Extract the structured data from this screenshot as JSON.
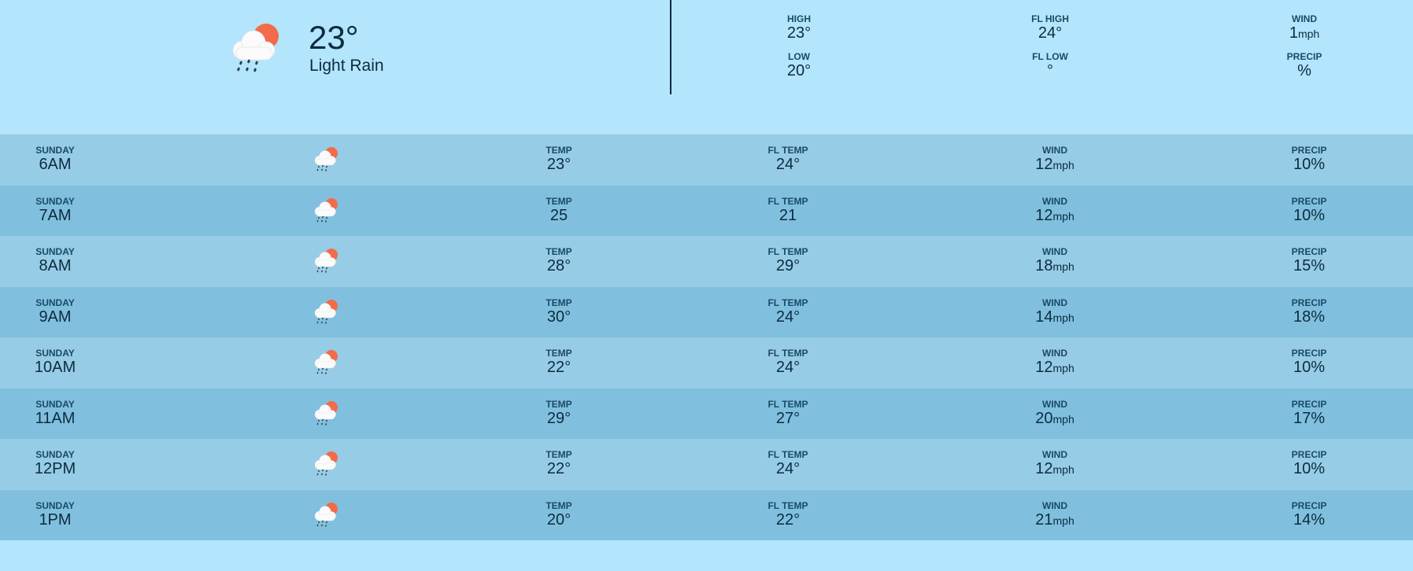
{
  "current": {
    "icon": "cloud-sun-rain-icon",
    "temp": "23°",
    "condition": "Light Rain"
  },
  "stats": {
    "high": {
      "label": "HIGH",
      "value": "23°"
    },
    "low": {
      "label": "LOW",
      "value": "20°"
    },
    "fl_high": {
      "label": "FL HIGH",
      "value": "24°"
    },
    "fl_low": {
      "label": "FL LOW",
      "value": "°"
    },
    "wind": {
      "label": "WIND",
      "value": "1",
      "unit": "mph"
    },
    "precip": {
      "label": "PRECIP",
      "value": "%"
    }
  },
  "labels": {
    "temp": "TEMP",
    "fl_temp": "FL TEMP",
    "wind": "WIND",
    "precip": "PRECIP",
    "wind_unit": "mph"
  },
  "colors": {
    "background": "#b3e5fc",
    "row_odd": "#96cce6",
    "row_even": "#80c0de",
    "sun": "#f26b4a",
    "text": "#0d2b3e"
  },
  "hourly": [
    {
      "day": "SUNDAY",
      "time": "6AM",
      "icon": "cloud-sun-rain-icon",
      "temp": "23°",
      "fl_temp": "24°",
      "wind": "12",
      "precip": "10%"
    },
    {
      "day": "SUNDAY",
      "time": "7AM",
      "icon": "cloud-sun-rain-icon",
      "temp": "25",
      "fl_temp": "21",
      "wind": "12",
      "precip": "10%"
    },
    {
      "day": "SUNDAY",
      "time": "8AM",
      "icon": "cloud-sun-rain-icon",
      "temp": "28°",
      "fl_temp": "29°",
      "wind": "18",
      "precip": "15%"
    },
    {
      "day": "SUNDAY",
      "time": "9AM",
      "icon": "cloud-sun-rain-icon",
      "temp": "30°",
      "fl_temp": "24°",
      "wind": "14",
      "precip": "18%"
    },
    {
      "day": "SUNDAY",
      "time": "10AM",
      "icon": "cloud-sun-rain-icon",
      "temp": "22°",
      "fl_temp": "24°",
      "wind": "12",
      "precip": "10%"
    },
    {
      "day": "SUNDAY",
      "time": "11AM",
      "icon": "cloud-sun-rain-icon",
      "temp": "29°",
      "fl_temp": "27°",
      "wind": "20",
      "precip": "17%"
    },
    {
      "day": "SUNDAY",
      "time": "12PM",
      "icon": "cloud-sun-rain-icon",
      "temp": "22°",
      "fl_temp": "24°",
      "wind": "12",
      "precip": "10%"
    },
    {
      "day": "SUNDAY",
      "time": "1PM",
      "icon": "cloud-sun-rain-icon",
      "temp": "20°",
      "fl_temp": "22°",
      "wind": "21",
      "precip": "14%"
    }
  ]
}
